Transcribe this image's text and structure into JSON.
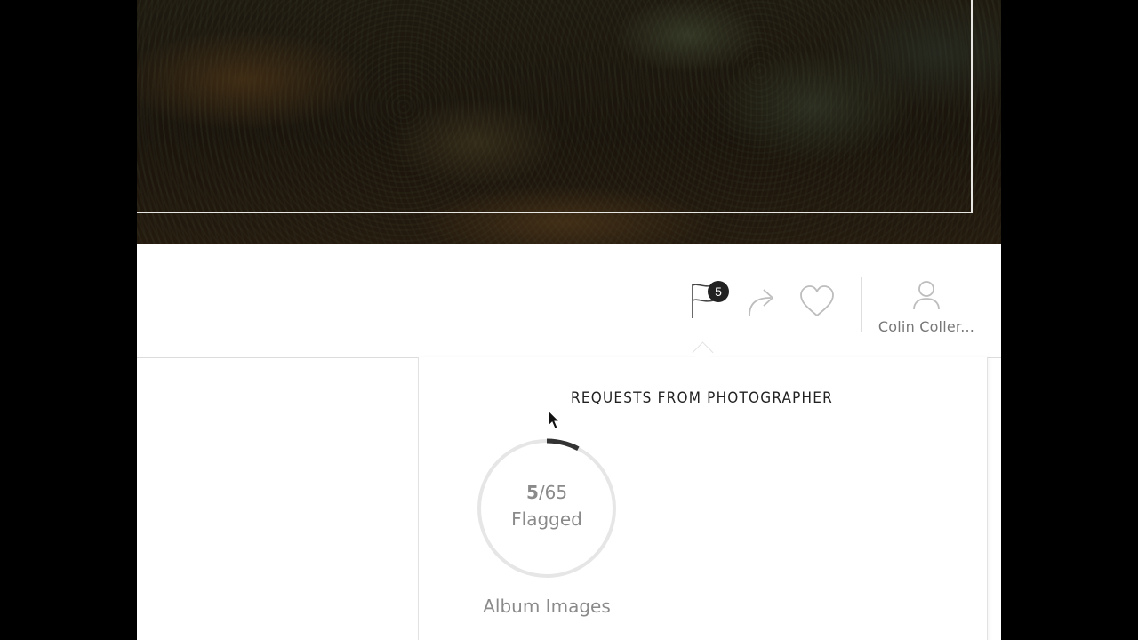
{
  "toolbar": {
    "flag_count": "5",
    "user_name": "Colin Coller..."
  },
  "icons": {
    "flag": "flag-icon",
    "share": "share-arrow-icon",
    "heart": "heart-icon",
    "user": "user-avatar-icon"
  },
  "requests_panel": {
    "title": "REQUESTS FROM PHOTOGRAPHER",
    "flagged_count": "5",
    "total_count": "/65",
    "flagged_label": "Flagged",
    "progress_fraction": 0.077,
    "album_label": "Album Images"
  },
  "colors": {
    "badge": "#222222",
    "ring_track": "#e6e6e6",
    "ring_progress": "#333333",
    "muted_text": "#8a8a8a"
  }
}
